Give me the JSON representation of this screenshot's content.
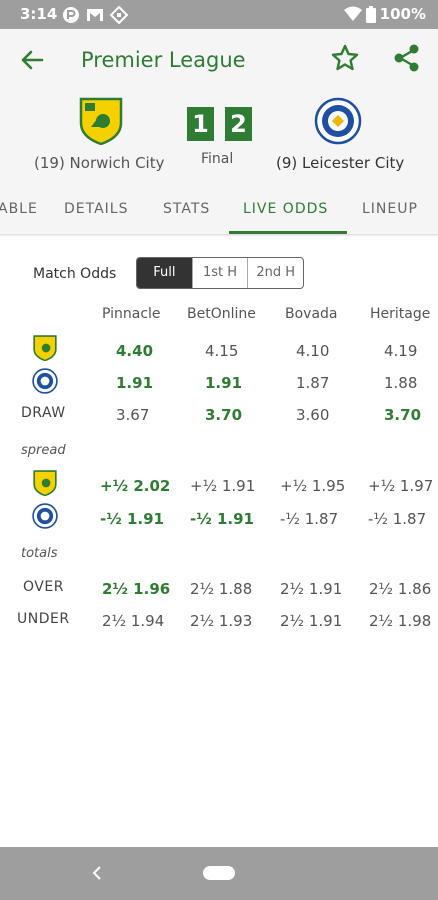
{
  "status_bar": {
    "time": "3:14",
    "battery": "100%"
  },
  "header": {
    "title": "Premier League"
  },
  "match": {
    "home": {
      "name": "(19) Norwich City",
      "score": "1"
    },
    "away": {
      "name": "(9) Leicester City",
      "score": "2"
    },
    "status": "Final"
  },
  "tabs": [
    "ABLE",
    "DETAILS",
    "STATS",
    "LIVE ODDS",
    "LINEUP"
  ],
  "active_tab": "LIVE ODDS",
  "odds": {
    "market_label": "Match Odds",
    "periods": [
      "Full",
      "1st H",
      "2nd H"
    ],
    "selected_period": "Full",
    "bookmakers": [
      "Pinnacle",
      "BetOnline",
      "Bovada",
      "Heritage"
    ],
    "moneyline": [
      {
        "label": "",
        "values": [
          "4.40",
          "4.15",
          "4.10",
          "4.19"
        ]
      },
      {
        "label": "",
        "values": [
          "1.91",
          "1.91",
          "1.87",
          "1.88"
        ]
      },
      {
        "label": "DRAW",
        "values": [
          "3.67",
          "3.70",
          "3.60",
          "3.70"
        ]
      }
    ],
    "spread_label": "spread",
    "spread": [
      {
        "values": [
          "+½  2.02",
          "+½  1.91",
          "+½  1.95",
          "+½  1.97"
        ]
      },
      {
        "values": [
          "-½  1.91",
          "-½  1.91",
          "-½  1.87",
          "-½  1.87"
        ]
      }
    ],
    "totals_label": "totals",
    "totals": [
      {
        "label": "OVER",
        "values": [
          "2½ 1.96",
          "2½ 1.88",
          "2½ 1.91",
          "2½ 1.86"
        ]
      },
      {
        "label": "UNDER",
        "values": [
          "2½ 1.94",
          "2½ 1.93",
          "2½ 1.91",
          "2½ 1.98"
        ]
      }
    ]
  },
  "colors": {
    "accent": "#2e7d32",
    "status_bar": "#9e9e9e",
    "header_bg": "#f5f5f5",
    "norwich_yellow": "#f5d100",
    "leicester_blue": "#1f4fa3"
  }
}
